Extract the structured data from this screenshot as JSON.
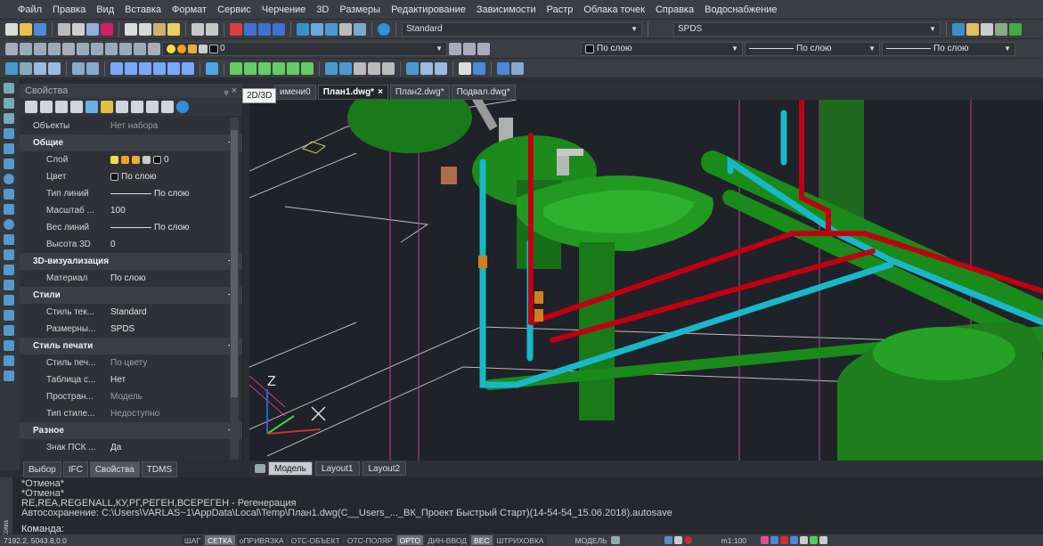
{
  "menu": [
    "Файл",
    "Правка",
    "Вид",
    "Вставка",
    "Формат",
    "Сервис",
    "Черчение",
    "3D",
    "Размеры",
    "Редактирование",
    "Зависимости",
    "Растр",
    "Облака точек",
    "Справка",
    "Водоснабжение"
  ],
  "toolbar": {
    "text_style": "Standard",
    "dim_style": "SPDS",
    "layer_combo": "0",
    "layer_prop": "По слою",
    "linetype": "По слою",
    "lineweight": "По слою"
  },
  "properties": {
    "title": "Свойства",
    "pin": "ᵩ ×",
    "objects_label": "Объекты",
    "objects_value": "Нет набора",
    "categories": [
      {
        "name": "Общие",
        "rows": [
          {
            "label": "Слой",
            "value": "0"
          },
          {
            "label": "Цвет",
            "value": "По слою"
          },
          {
            "label": "Тип линий",
            "value": "По слою"
          },
          {
            "label": "Масштаб ...",
            "value": "100"
          },
          {
            "label": "Вес линий",
            "value": "По слою"
          },
          {
            "label": "Высота 3D",
            "value": "0"
          }
        ]
      },
      {
        "name": "3D-визуализация",
        "rows": [
          {
            "label": "Материал",
            "value": "По слою"
          }
        ]
      },
      {
        "name": "Стили",
        "rows": [
          {
            "label": "Стиль тек...",
            "value": "Standard"
          },
          {
            "label": "Размерны...",
            "value": "SPDS"
          }
        ]
      },
      {
        "name": "Стиль печати",
        "rows": [
          {
            "label": "Стиль печ...",
            "value": "По цвету"
          },
          {
            "label": "Таблица с...",
            "value": "Нет"
          },
          {
            "label": "Простран...",
            "value": "Модель"
          },
          {
            "label": "Тип стиле...",
            "value": "Недоступно"
          }
        ]
      },
      {
        "name": "Разное",
        "rows": [
          {
            "label": "Знак ПСК ...",
            "value": "Да"
          }
        ]
      }
    ],
    "tabs": [
      "Выбор",
      "IFC",
      "Свойства",
      "TDMS"
    ]
  },
  "doc_tabs": [
    "2D/3D",
    "имени0",
    "План1.dwg*",
    "План2.dwg*",
    "Подвал.dwg*"
  ],
  "layout_tabs": [
    "Модель",
    "Layout1",
    "Layout2"
  ],
  "command": {
    "lines": [
      "*Отмена*",
      "*Отмена*",
      "RE,REA,REGENALL,КУ,РГ,РЕГЕН,ВСЕРЕГЕН - Регенерация",
      "Автосохранение: C:\\Users\\VARLAS~1\\AppData\\Local\\Temp\\План1.dwg(C__Users_..._ВК_Проект Быстрый Старт)(14-54-54_15.06.2018).autosave"
    ],
    "prompt": "Команда:",
    "side_label": "Кома"
  },
  "status": {
    "coords": "7192.2, 5043.8,0.0",
    "buttons": [
      "ШАГ",
      "СЕТКА",
      "оПРИВЯЗКА",
      "ОТС-ОБЪЕКТ",
      "ОТС-ПОЛЯР",
      "ОРТО",
      "ДИН-ВВОД",
      "ВЕС",
      "ШТРИХОВКА"
    ],
    "active": [
      "СЕТКА",
      "ОРТО",
      "ВЕС"
    ],
    "model": "МОДЕЛЬ",
    "scale": "m1:100"
  },
  "ucs": {
    "z": "Z"
  },
  "colors": {
    "pipe_red": "#c00010",
    "pipe_cyan": "#18b8c8",
    "fixture_green": "#1a8a1a",
    "accent": "#2f8fd8"
  }
}
